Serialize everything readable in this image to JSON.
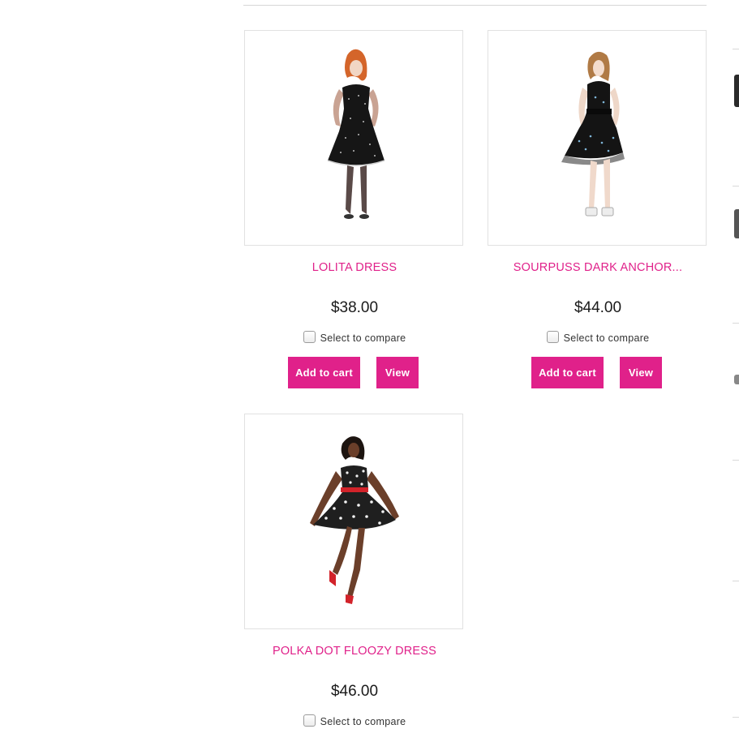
{
  "products": [
    {
      "name": "LOLITA DRESS",
      "price": "$38.00",
      "compare_label": "Select to compare",
      "add_to_cart_label": "Add to cart",
      "view_label": "View"
    },
    {
      "name": "SOURPUSS DARK ANCHOR...",
      "price": "$44.00",
      "compare_label": "Select to compare",
      "add_to_cart_label": "Add to cart",
      "view_label": "View"
    },
    {
      "name": "POLKA DOT FLOOZY DRESS",
      "price": "$46.00",
      "compare_label": "Select to compare"
    }
  ],
  "colors": {
    "accent": "#e0218a",
    "border": "#e1e1e1",
    "divider": "#d6d6d6"
  }
}
